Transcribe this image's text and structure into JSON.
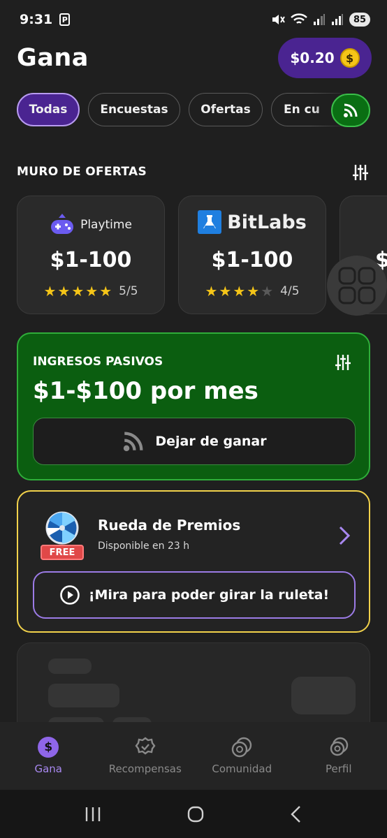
{
  "status_bar": {
    "time": "9:31",
    "battery": "85"
  },
  "header": {
    "title": "Gana",
    "balance": "$0.20",
    "coin_symbol": "$"
  },
  "chips": [
    {
      "label": "Todas",
      "active": true
    },
    {
      "label": "Encuestas",
      "active": false
    },
    {
      "label": "Ofertas",
      "active": false
    },
    {
      "label": "En cu",
      "active": false
    }
  ],
  "offer_wall": {
    "title": "MURO DE OFERTAS",
    "cards": [
      {
        "brand": "Playtime",
        "range": "$1-100",
        "stars": 5,
        "rating": "5/5"
      },
      {
        "brand": "BitLabs",
        "range": "$1-100",
        "stars": 4,
        "rating": "4/5"
      },
      {
        "range": "$"
      }
    ]
  },
  "passive_income": {
    "label": "INGRESOS PASIVOS",
    "amount": "$1-$100 por mes",
    "button_label": "Dejar de ganar"
  },
  "prize_wheel": {
    "title": "Rueda de Premios",
    "subtitle": "Disponible en 23 h",
    "tag": "FREE",
    "button_label": "¡Mira para poder girar la ruleta!"
  },
  "bottom_nav": {
    "items": [
      {
        "label": "Gana",
        "active": true
      },
      {
        "label": "Recompensas",
        "active": false
      },
      {
        "label": "Comunidad",
        "active": false
      },
      {
        "label": "Perfil",
        "active": false
      }
    ]
  },
  "colors": {
    "background": "#1f1f1f",
    "accent_purple": "#4a2491",
    "accent_green": "#0b5e10",
    "accent_yellow": "#f2d24b",
    "star": "#f5c518"
  }
}
